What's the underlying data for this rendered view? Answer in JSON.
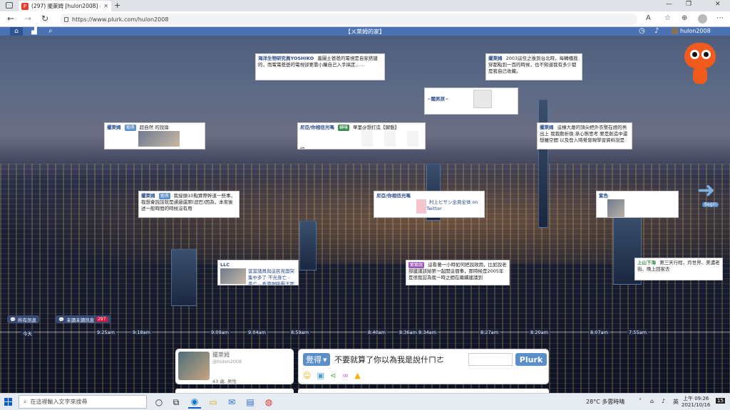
{
  "browser": {
    "tab_title": "(297) 擺萊姆 [hulon2008] - Plurk",
    "favicon_text": "P",
    "url": "https://www.plurk.com/hulon2008",
    "new_tab": "+",
    "minimize": "—",
    "maximize": "❐",
    "close": "✕"
  },
  "plurk_header": {
    "title": "【ㄨ萊姆的家】",
    "username": "hulon2008"
  },
  "cards": [
    {
      "author": "海洋生物研究員YOSHIKO",
      "text": "蓋圖士爸爸的電視是自家搭建的，而電電爸爸的電視卻要靠小蘿自己入手搞定……",
      "count": "2"
    },
    {
      "author": "擺萊姆",
      "text": "2003這任之後到台北時，每轉橋我穿都點到一百的時候，也不知道我有多少都是我自己收藏。",
      "count": "2"
    },
    {
      "author": "~闊男孩~",
      "text": "",
      "count": "1"
    },
    {
      "author": "擺萊姆",
      "qualifier": "覺得",
      "text": "超自然 的說論",
      "count": "4"
    },
    {
      "author": "尼亞/你相信光嗎",
      "qualifier": "轉噗",
      "text": "華里@想打造【鍵盤】",
      "tail": "統",
      "count": "1"
    },
    {
      "author": "擺萊姆",
      "text": "這棟大廈的頂尖把外衣警在燈的亮出上 我我動折換 承心態思考 要是創造中還想雖空間 以及登入時覺發現學習資料說是",
      "count": "2"
    },
    {
      "author": "擺萊姆",
      "qualifier": "覺得",
      "text": "我接頭10點實際幹道一些事，我想會說話就是通過還原(逗巴)因為，本來後述一般時間的時候沒有用",
      "count": ""
    },
    {
      "author": "尼亞/你相信光嗎",
      "text": "村上ヒサシ全見全体 on Twitter",
      "count": ""
    },
    {
      "author": "紫色",
      "text": "",
      "count": "5"
    },
    {
      "author": "LLC",
      "text": "當當議員與這民見面突集中多了 不光身亡 - 茶亡 - 香港咖啡霸王那",
      "count": ""
    },
    {
      "author": "紫紫說",
      "text": "這看著一小時如何把說政用，比如說老部建議該給第一起開這個事，那時候是2005年是很我認為我一時之間在繼續建議到",
      "count": ""
    },
    {
      "author": "上山下海",
      "text": "第三天行程，月世界、美濃老街、晚上回家去",
      "count": ""
    }
  ],
  "timeline": {
    "labels": [
      "今天",
      "9:25am",
      "9:18am",
      "9:09am",
      "9:04am",
      "8:59am",
      "8:40am",
      "8:36am",
      "8:34am",
      "8:27am",
      "8:20am",
      "8:07am",
      "7:55am"
    ]
  },
  "filters": {
    "all": "所有訊息",
    "unread": "未讀未讀訊息",
    "unread_count": "297"
  },
  "profile": {
    "name": "擺萊姆",
    "handle": "@hulon2008",
    "age": "43 歲, 男性"
  },
  "composer": {
    "qualifier": "覺得",
    "text": "不要就算了你以為我是說什ㄇㄜ",
    "send": "Plurk"
  },
  "right_panel": {
    "begin": "Begin"
  },
  "taskbar": {
    "search_placeholder": "在這裡輸入文字來搜尋",
    "weather": "28°C 多雲時晴",
    "ime": "英",
    "time": "上午 09:26",
    "date": "2021/10/16",
    "notif": "15"
  },
  "colors": {
    "plurk_blue": "#4a73b5",
    "count_red": "#e0143c",
    "mascot_orange": "#f05a1c"
  }
}
